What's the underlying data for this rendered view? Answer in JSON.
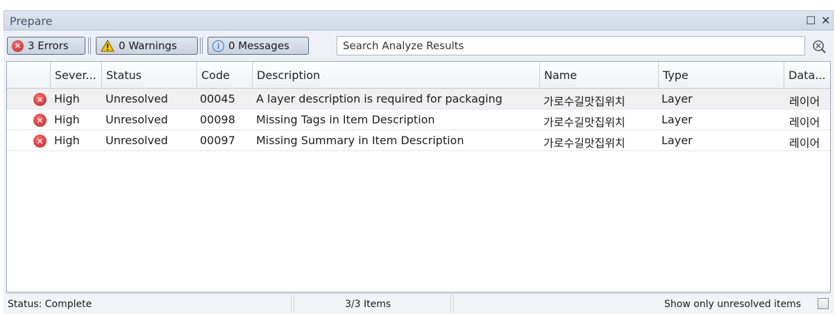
{
  "panel": {
    "title": "Prepare",
    "maximize_glyph": "☐",
    "close_glyph": "✕"
  },
  "toolbar": {
    "errors_label": "3 Errors",
    "warnings_label": "0 Warnings",
    "messages_label": "0 Messages",
    "search_placeholder": "Search Analyze Results",
    "error_icon": "error-icon",
    "warning_icon": "warning-icon",
    "info_icon": "info-icon"
  },
  "columns": [
    "Sever...",
    "Status",
    "Code",
    "Description",
    "Name",
    "Type",
    "Data..."
  ],
  "rows": [
    {
      "severity": "High",
      "status": "Unresolved",
      "code": "00045",
      "description": "A layer description is required for packaging",
      "name": "가로수길맛집위치",
      "type": "Layer",
      "data": "레이어"
    },
    {
      "severity": "High",
      "status": "Unresolved",
      "code": "00098",
      "description": "Missing Tags in Item Description",
      "name": "가로수길맛집위치",
      "type": "Layer",
      "data": "레이어"
    },
    {
      "severity": "High",
      "status": "Unresolved",
      "code": "00097",
      "description": "Missing Summary in Item Description",
      "name": "가로수길맛집위치",
      "type": "Layer",
      "data": "레이어"
    }
  ],
  "status": {
    "status_text": "Status: Complete",
    "items_text": "3/3 Items",
    "filter_label": "Show only unresolved items",
    "filter_checked": false
  },
  "colors": {
    "error": "#c1232b",
    "warning": "#f2c200",
    "info": "#2d6fc9"
  }
}
